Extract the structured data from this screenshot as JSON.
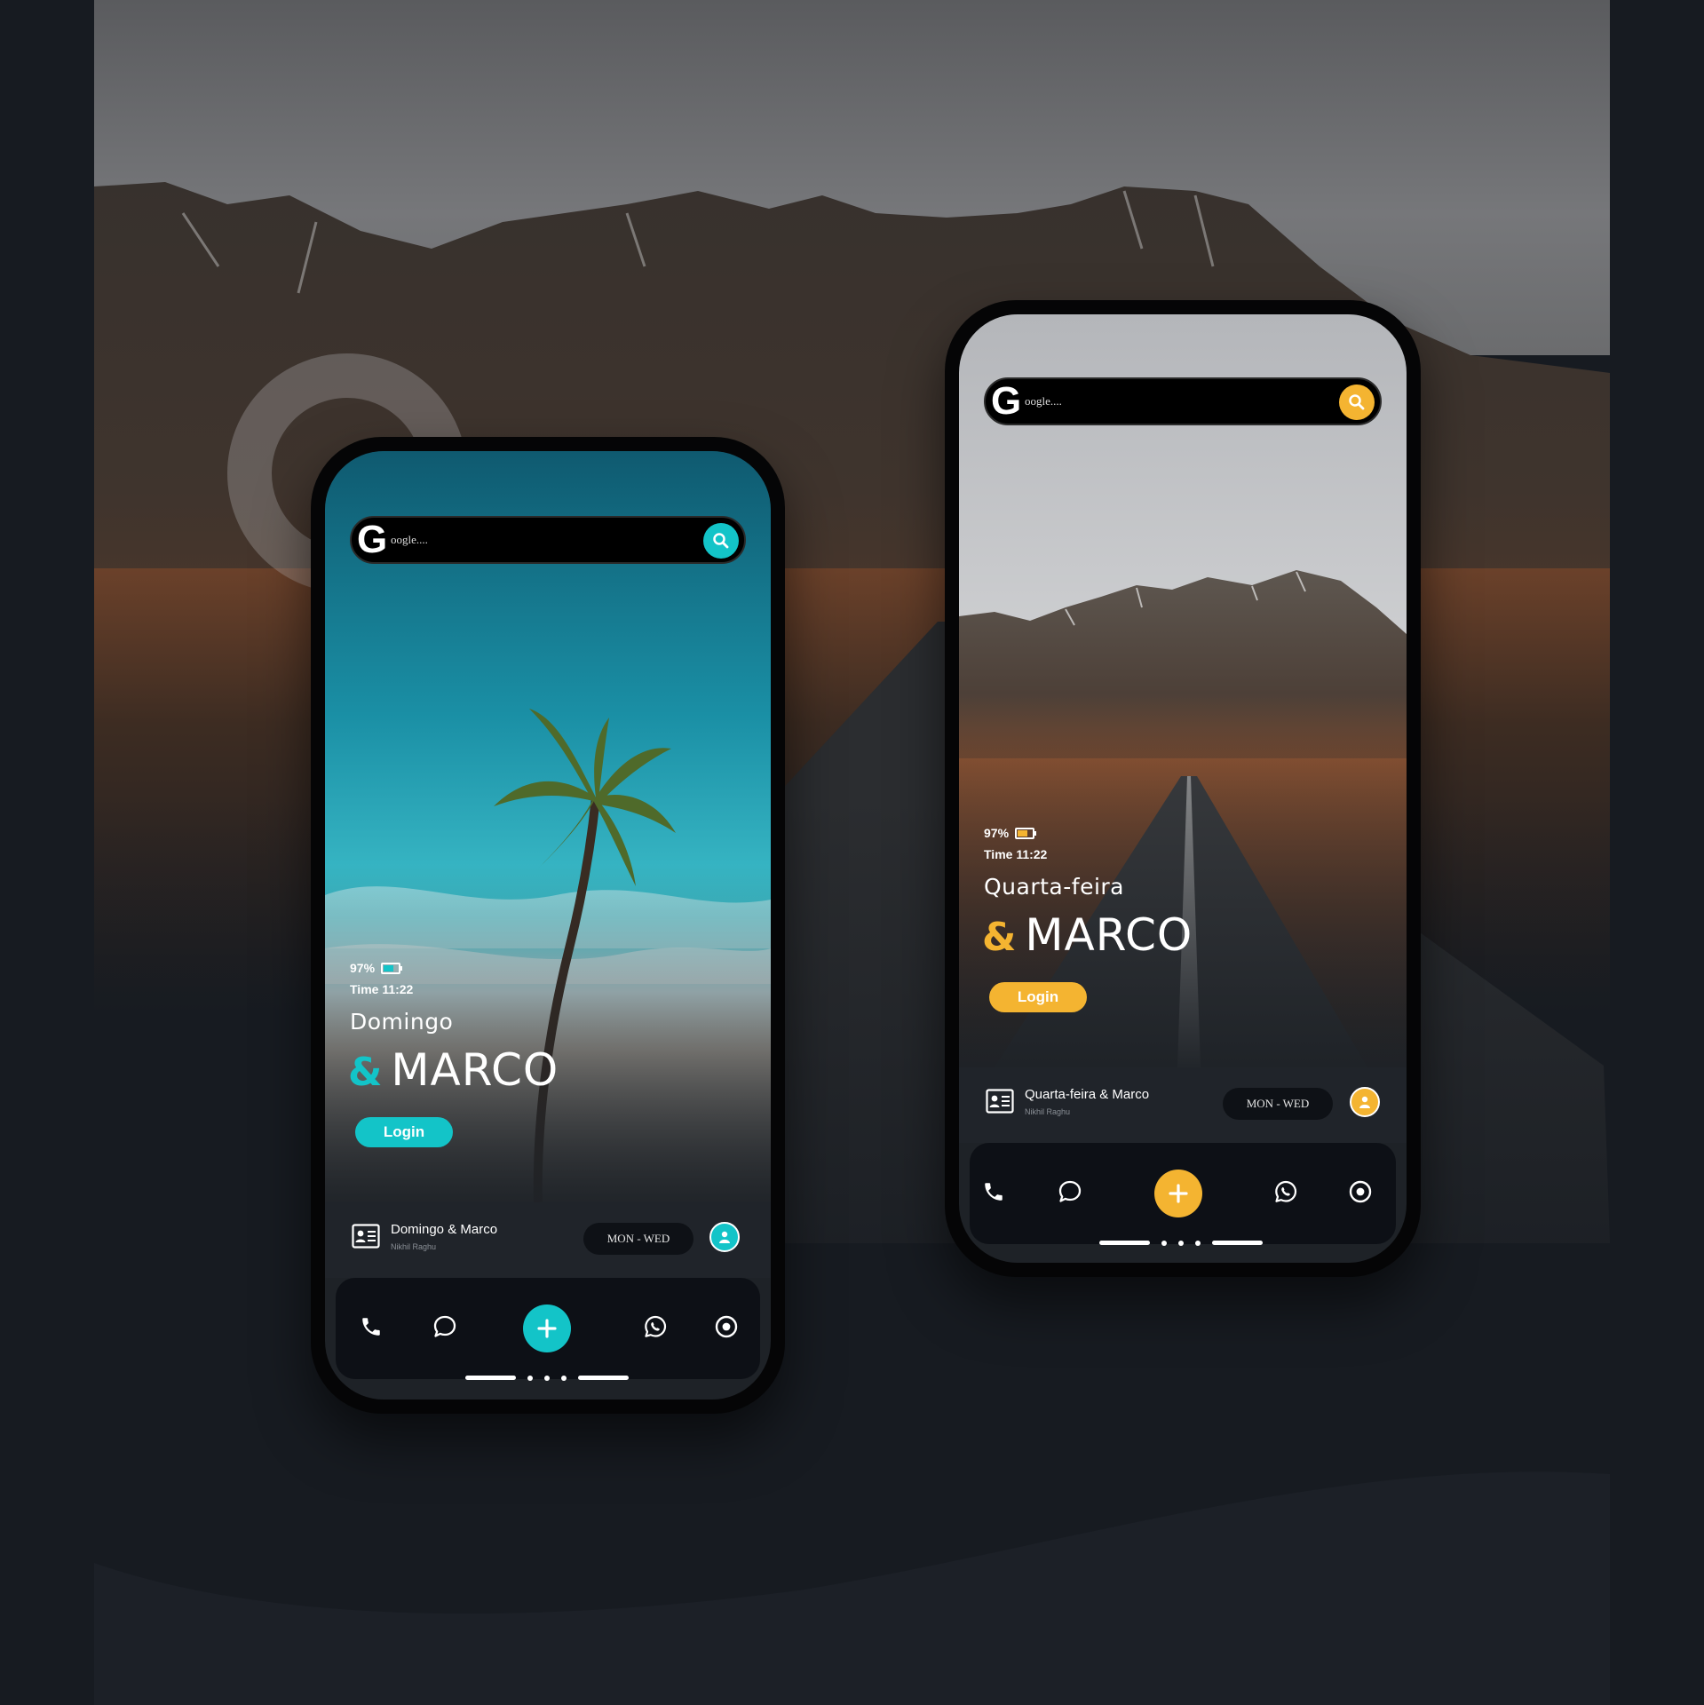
{
  "theme": {
    "teal": "#13c4c8",
    "amber": "#f4b431",
    "background": "#171b21"
  },
  "phone_left": {
    "search": {
      "logo": "G",
      "placeholder": "oogle...."
    },
    "battery": "97%",
    "time": "Time 11:22",
    "day": "Domingo",
    "ampersand": "&",
    "name": "MARCO",
    "login_label": "Login",
    "contact_title": "Domingo & Marco",
    "contact_subtitle": "Nikhil Raghu",
    "days": "MON  -  WED",
    "icons": [
      "phone-icon",
      "chat-bubble-icon",
      "plus-icon",
      "whatsapp-icon",
      "record-icon"
    ]
  },
  "phone_right": {
    "search": {
      "logo": "G",
      "placeholder": "oogle...."
    },
    "battery": "97%",
    "time": "Time 11:22",
    "day": "Quarta-feira",
    "ampersand": "&",
    "name": "MARCO",
    "login_label": "Login",
    "contact_title": "Quarta-feira & Marco",
    "contact_subtitle": "Nikhil Raghu",
    "days": "MON  -  WED",
    "icons": [
      "phone-icon",
      "chat-bubble-icon",
      "plus-icon",
      "whatsapp-icon",
      "record-icon"
    ]
  }
}
